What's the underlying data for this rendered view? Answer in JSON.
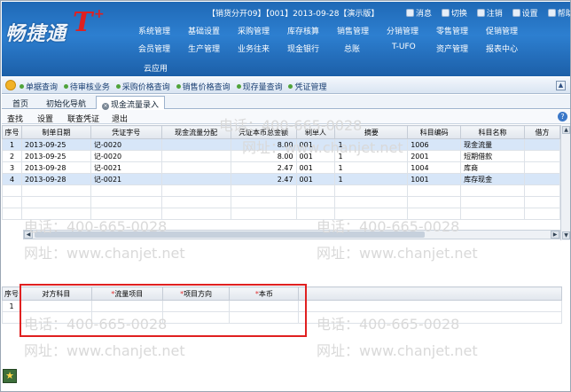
{
  "header": {
    "logo_text": "畅捷通",
    "logo_mark": "T",
    "logo_plus": "+",
    "info": "【销货分开09】【001】2013-09-28【演示版】",
    "links": [
      {
        "label": "消息",
        "icon": "message-icon"
      },
      {
        "label": "切换",
        "icon": "switch-icon"
      },
      {
        "label": "注销",
        "icon": "logout-icon"
      },
      {
        "label": "设置",
        "icon": "gear-icon"
      },
      {
        "label": "帮助",
        "icon": "help-icon"
      }
    ],
    "menu_row1": [
      "系统管理",
      "基础设置",
      "采购管理",
      "库存核算",
      "销售管理",
      "分销管理",
      "零售管理",
      "促销管理"
    ],
    "menu_row2": [
      "会员管理",
      "生产管理",
      "业务往来",
      "现金银行",
      "总账",
      "T-UFO",
      "资产管理",
      "报表中心"
    ],
    "menu_row3": [
      "云应用"
    ]
  },
  "func_toolbar": {
    "items": [
      "单据查询",
      "待审核业务",
      "采购价格查询",
      "销售价格查询",
      "现存量查询",
      "凭证管理"
    ]
  },
  "tabs": [
    {
      "label": "首页",
      "active": false
    },
    {
      "label": "初始化导航",
      "active": false
    },
    {
      "label": "现金流量录入",
      "active": true
    }
  ],
  "actions": [
    "查找",
    "设置",
    "联查凭证",
    "退出"
  ],
  "grid1": {
    "headers": [
      "序号",
      "制单日期",
      "凭证字号",
      "现金流量分配",
      "凭证本币总金额",
      "制单人",
      "摘要",
      "科目编码",
      "科目名称",
      "借方"
    ],
    "rows": [
      [
        "1",
        "2013-09-25",
        "记-0020",
        "",
        "8.00",
        "001",
        "1",
        "1006",
        "现金流量",
        ""
      ],
      [
        "2",
        "2013-09-25",
        "记-0020",
        "",
        "8.00",
        "001",
        "1",
        "2001",
        "短期借款",
        ""
      ],
      [
        "3",
        "2013-09-28",
        "记-0021",
        "",
        "2.47",
        "001",
        "1",
        "1004",
        "库商",
        ""
      ],
      [
        "4",
        "2013-09-28",
        "记-0021",
        "",
        "2.47",
        "001",
        "1",
        "1001",
        "库存现金",
        ""
      ]
    ],
    "selected_rows": [
      1,
      4
    ]
  },
  "grid2": {
    "headers": [
      {
        "label": "序号",
        "required": false
      },
      {
        "label": "对方科目",
        "required": false
      },
      {
        "label": "流量项目",
        "required": true
      },
      {
        "label": "项目方向",
        "required": true
      },
      {
        "label": "本币",
        "required": true
      }
    ],
    "rows": [
      [
        "1",
        "",
        "",
        "",
        ""
      ]
    ]
  },
  "watermark": {
    "phone": "电话：400-665-0028",
    "site": "网址：www.chanjet.net"
  },
  "colors": {
    "accent": "#2d7fd0",
    "highlight_box": "#e02020"
  }
}
